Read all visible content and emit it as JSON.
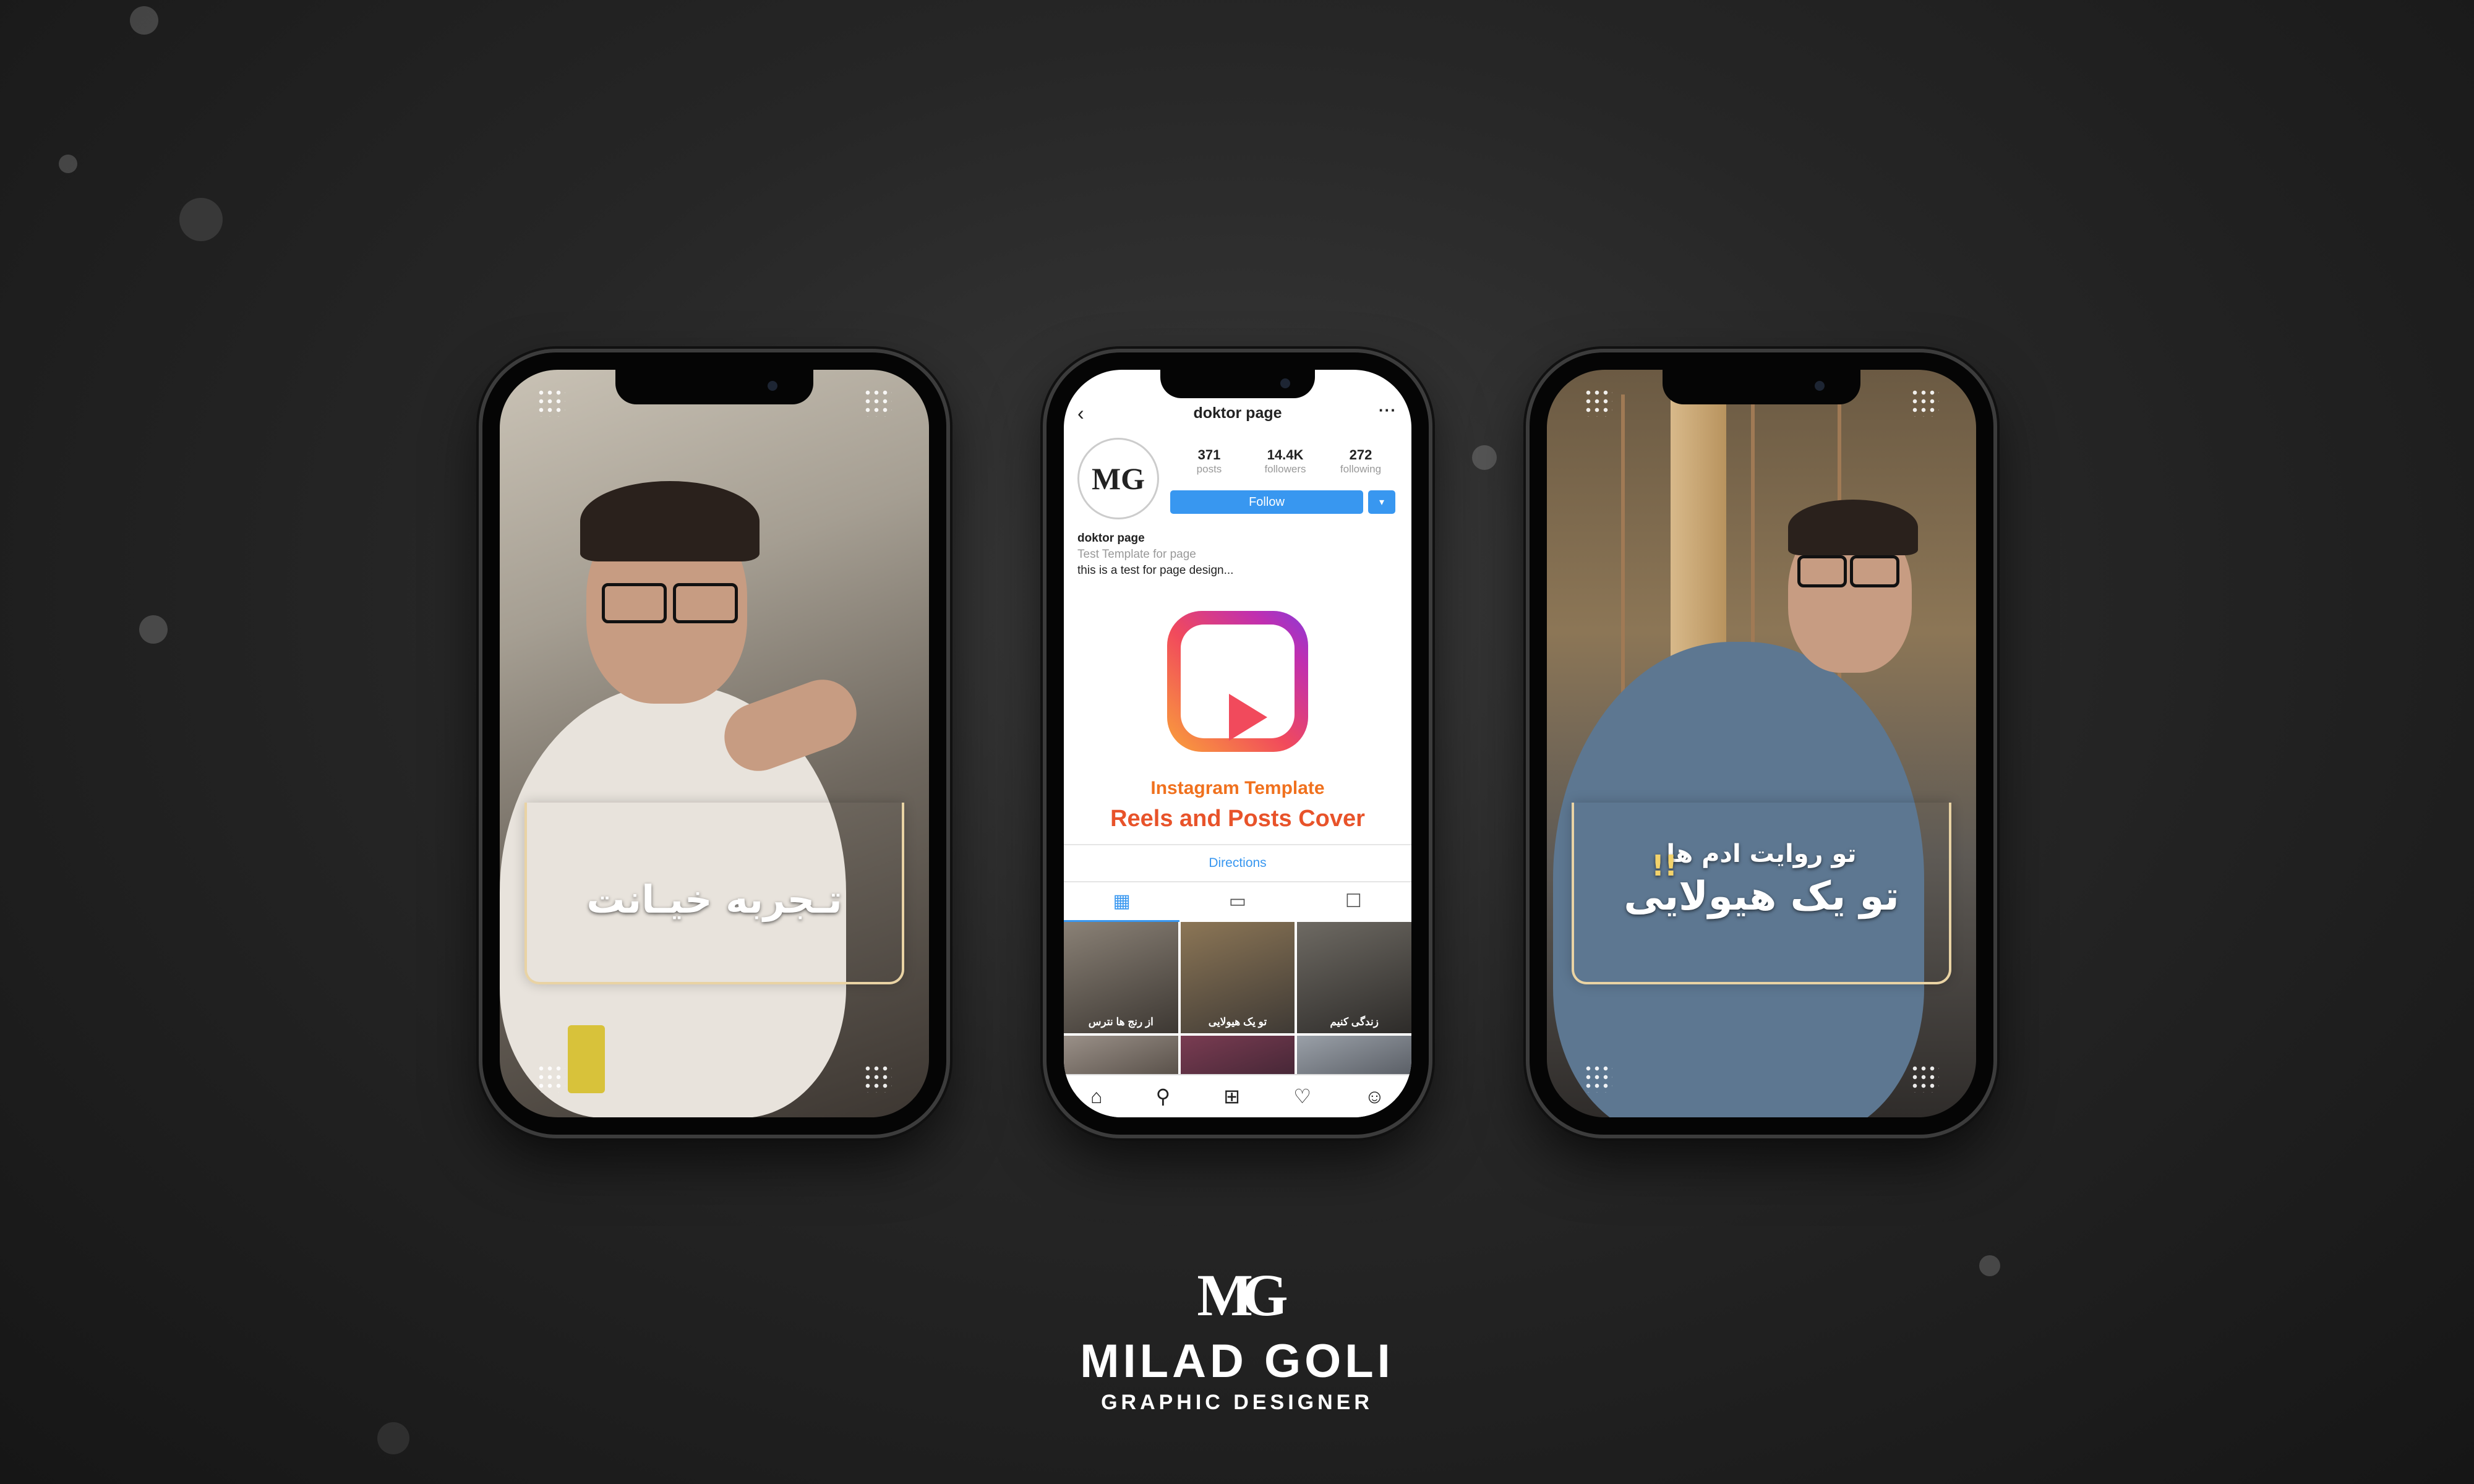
{
  "left_story": {
    "caption": "تـجربه خیـانت"
  },
  "right_story": {
    "caption_small": "تو روایت ادم ها",
    "caption_big": "تو یک هیولایی",
    "caption_mark": "!!"
  },
  "instagram": {
    "username": "doktor page",
    "back_icon": "chevron-left-icon",
    "more_icon": "more-icon",
    "avatar_monogram": "MG",
    "stats": [
      {
        "value": "371",
        "label": "posts"
      },
      {
        "value": "14.4K",
        "label": "followers"
      },
      {
        "value": "272",
        "label": "following"
      }
    ],
    "follow_label": "Follow",
    "follow_dropdown": "▾",
    "bio_name": "doktor page",
    "bio_category": "Test Template for page",
    "bio_text": "this is a test for page design...",
    "promo_line1": "Instagram Template",
    "promo_line2": "Reels and Posts Cover",
    "directions_label": "Directions",
    "tabs": [
      {
        "icon": "grid-icon",
        "glyph": "▦"
      },
      {
        "icon": "igtv-icon",
        "glyph": "▭"
      },
      {
        "icon": "tagged-icon",
        "glyph": "☐"
      }
    ],
    "posts": [
      {
        "caption": "از رنج ها نترس"
      },
      {
        "caption": "تو یک هیولایی"
      },
      {
        "caption": "زندگی کنیم"
      },
      {
        "caption": ""
      },
      {
        "caption": ""
      },
      {
        "caption": ""
      }
    ],
    "navbar": [
      {
        "icon": "home-icon",
        "glyph": "⌂"
      },
      {
        "icon": "search-icon",
        "glyph": "⚲"
      },
      {
        "icon": "add-icon",
        "glyph": "⊞"
      },
      {
        "icon": "heart-icon",
        "glyph": "♡"
      },
      {
        "icon": "profile-icon",
        "glyph": "☺"
      }
    ]
  },
  "brand": {
    "monogram": "MG",
    "name": "MILAD GOLI",
    "subtitle": "GRAPHIC DESIGNER"
  },
  "colors": {
    "background": "#262626",
    "follow_blue": "#3897f0",
    "promo_orange": "#e8532a",
    "caption_gold": "#e9d3a4"
  }
}
